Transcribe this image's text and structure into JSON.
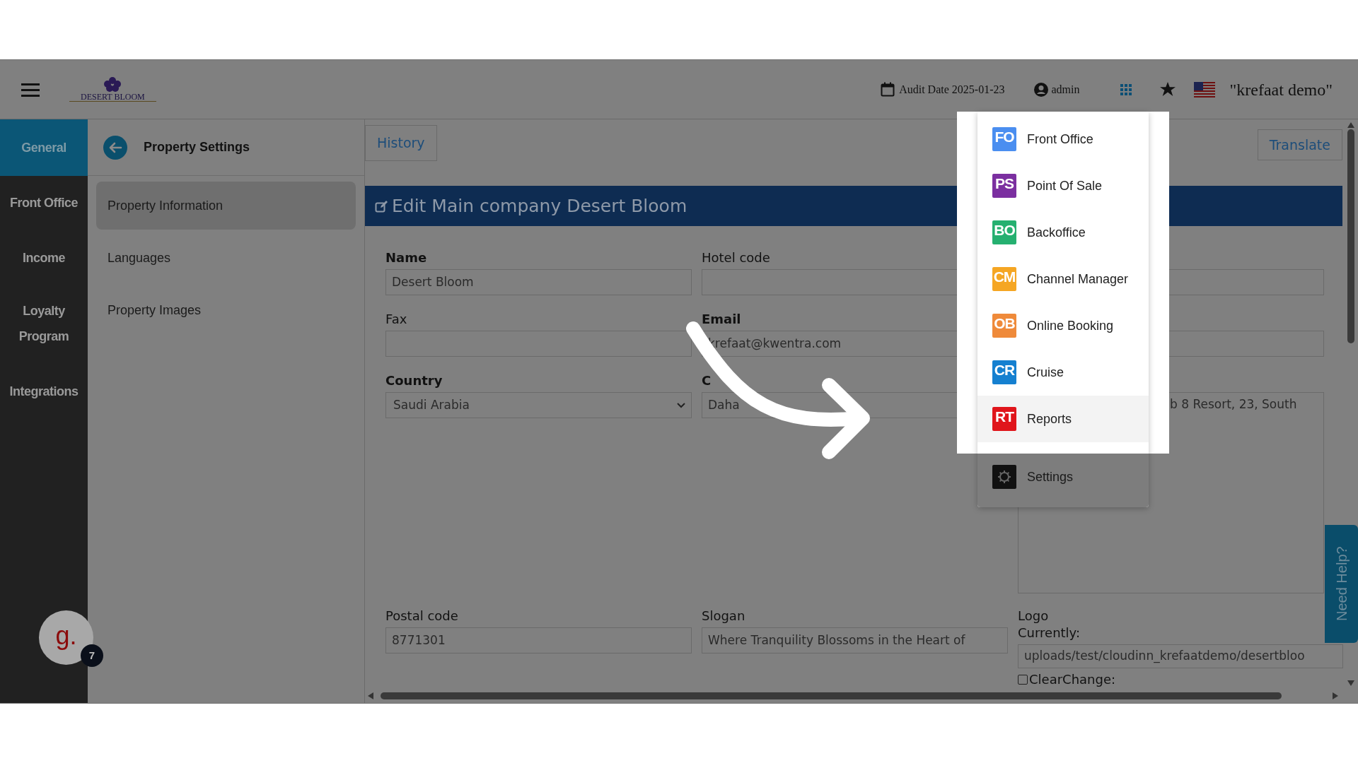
{
  "header": {
    "logo_text": "DESERT BLOOM",
    "audit_date": "Audit Date 2025-01-23",
    "user": "admin",
    "property": "\"krefaat demo\""
  },
  "modules": [
    {
      "label": "General",
      "selected": true
    },
    {
      "label": "Front Office",
      "selected": false
    },
    {
      "label": "Income",
      "selected": false
    },
    {
      "label": "Loyalty Program",
      "selected": false
    },
    {
      "label": "Integrations",
      "selected": false
    }
  ],
  "settings_panel": {
    "title": "Property Settings",
    "items": [
      {
        "label": "Property Information",
        "selected": true
      },
      {
        "label": "Languages",
        "selected": false
      },
      {
        "label": "Property Images",
        "selected": false
      }
    ]
  },
  "toolbar": {
    "history": "History",
    "translate": "Translate"
  },
  "form": {
    "title": "Edit Main company Desert Bloom",
    "rows": [
      [
        {
          "kind": "text",
          "label": "Name",
          "required": true,
          "value": "Desert Bloom"
        },
        {
          "kind": "text",
          "label": "Hotel code",
          "required": false
        },
        {
          "kind": "text"
        }
      ],
      [
        {
          "kind": "text",
          "label": "Fax",
          "required": false
        },
        {
          "kind": "text",
          "label": "Email",
          "required": true,
          "value": "krefaat@kwentra.com"
        },
        {
          "kind": "text"
        }
      ],
      [
        {
          "kind": "select",
          "label": "Country",
          "required": true,
          "value": "Saudi Arabia"
        },
        {
          "kind": "text",
          "label": "C",
          "required": true,
          "value": "Daha"
        },
        {
          "kind": "textarea",
          "value": "b 8 Resort, 23, South"
        }
      ],
      [
        {
          "kind": "text",
          "label": "Postal code",
          "required": false,
          "value": "8771301"
        },
        {
          "kind": "text",
          "label": "Slogan",
          "required": false,
          "value": "Where Tranquility Blossoms in the Heart of"
        },
        {
          "kind": "file",
          "label": "Logo",
          "required": false,
          "current_label": "Currently:",
          "value": "uploads/test/cloudinn_krefaatdemo/desertbloo",
          "checkbox_label": "ClearChange:",
          "checked": false
        }
      ]
    ]
  },
  "app_menu": {
    "items": [
      {
        "kind": "letters",
        "code": "FO",
        "label": "Front Office",
        "color": "#4a8ef0",
        "selected": false
      },
      {
        "kind": "letters",
        "code": "PS",
        "label": "Point Of Sale",
        "color": "#7b2fa0",
        "selected": false
      },
      {
        "kind": "letters",
        "code": "BO",
        "label": "Backoffice",
        "color": "#25b070",
        "selected": false
      },
      {
        "kind": "letters",
        "code": "CM",
        "label": "Channel Manager",
        "color": "#f5a623",
        "selected": false
      },
      {
        "kind": "letters",
        "code": "OB",
        "label": "Online Booking",
        "color": "#ef8a3a",
        "selected": false
      },
      {
        "kind": "letters",
        "code": "CR",
        "label": "Cruise",
        "color": "#1580d0",
        "selected": false
      },
      {
        "kind": "letters",
        "code": "RT",
        "label": "Reports",
        "color": "#e0151b",
        "selected": true
      },
      {
        "kind": "gear",
        "label": "Settings",
        "color": "#111111",
        "selected": false
      }
    ]
  },
  "help_tab": "Need Help?",
  "chat": {
    "letter": "g.",
    "badge": "7"
  }
}
